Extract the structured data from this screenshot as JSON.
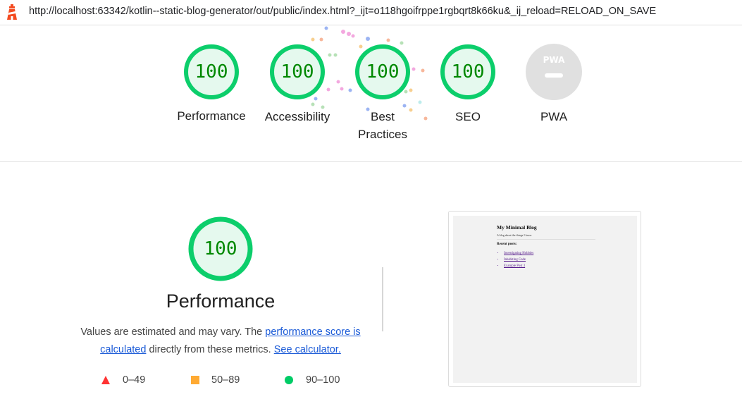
{
  "browser": {
    "url": "http://localhost:63342/kotlin--static-blog-generator/out/public/index.html?_ijt=o118hgoifrppe1rgbqrt8k66ku&_ij_reload=RELOAD_ON_SAVE",
    "logo_icon": "lighthouse-icon"
  },
  "gauges": [
    {
      "score": "100",
      "label": "Performance"
    },
    {
      "score": "100",
      "label": "Accessibility"
    },
    {
      "score": "100",
      "label": "Best Practices"
    },
    {
      "score": "100",
      "label": "SEO"
    },
    {
      "label": "PWA",
      "badge": "PWA"
    }
  ],
  "performance": {
    "score": "100",
    "title": "Performance",
    "desc_prefix": "Values are estimated and may vary. The ",
    "desc_link1": "performance score is calculated",
    "desc_mid": " directly from these metrics. ",
    "desc_link2": "See calculator."
  },
  "legend": [
    {
      "range": "0–49",
      "color": "#ff3333",
      "shape": "triangle"
    },
    {
      "range": "50–89",
      "color": "#ffaa33",
      "shape": "square"
    },
    {
      "range": "90–100",
      "color": "#00cc66",
      "shape": "circle"
    }
  ],
  "screenshot": {
    "title": "My Minimal Blog",
    "subtitle": "A blog about the things I know",
    "recent_heading": "Recent posts:",
    "posts": [
      "Investigating Hobbies",
      "Inhabiting Code",
      "Example Post 3"
    ]
  },
  "colors": {
    "pass": "#0cce6b",
    "pass_fill": "#e5f9ee",
    "pass_text": "#008800",
    "pwa_gray": "#e0e0e0"
  }
}
